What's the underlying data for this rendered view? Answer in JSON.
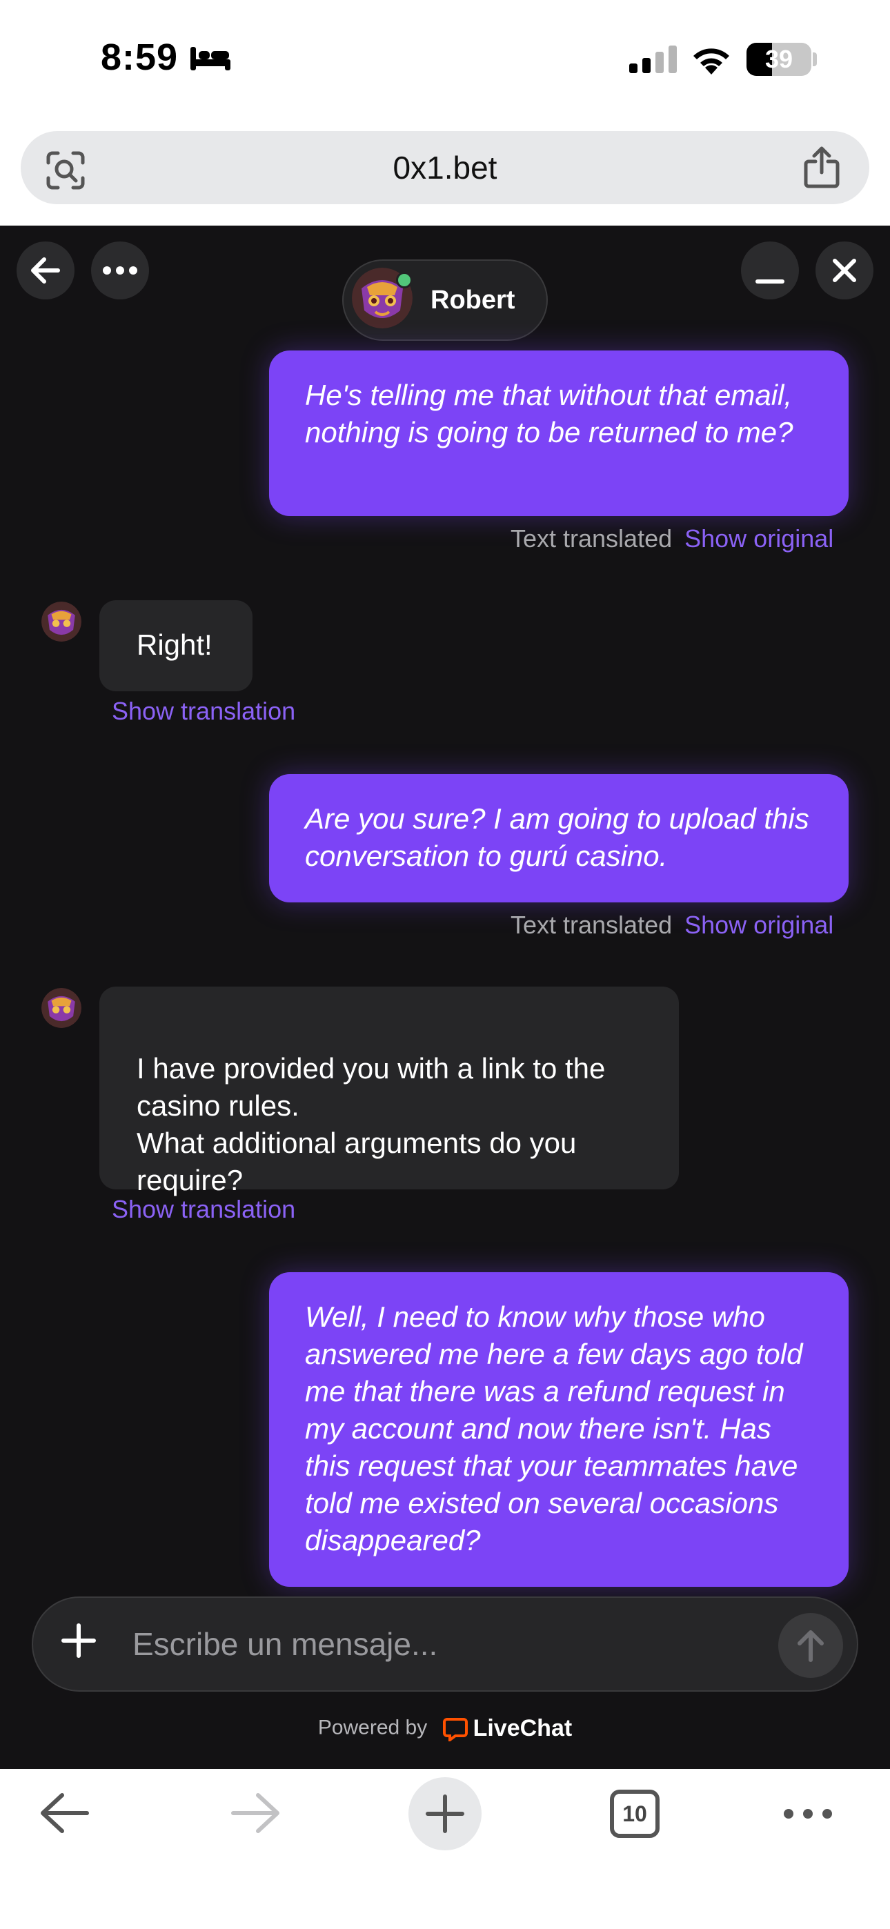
{
  "status_bar": {
    "time": "8:59",
    "battery": "39",
    "battery_level": 0.39
  },
  "browser": {
    "url": "0x1.bet"
  },
  "chat_header": {
    "agent_name": "Robert",
    "agent_online": true
  },
  "messages": [
    {
      "type": "outgoing",
      "text": "He's telling me that without that email, nothing is going to be returned to me?",
      "meta": "Text translated",
      "action": "Show original"
    },
    {
      "type": "incoming",
      "text": "Right!",
      "action": "Show translation"
    },
    {
      "type": "outgoing",
      "text": "Are you sure? I am going to upload this conversation to gurú casino.",
      "meta": "Text translated",
      "action": "Show original"
    },
    {
      "type": "incoming",
      "text": "I have provided you with a link to the casino rules.\nWhat additional arguments do you require?",
      "action": "Show translation"
    },
    {
      "type": "outgoing",
      "text": "Well, I need to know why those who answered me here a few days ago told me that there was a refund request in my account and now there isn't. Has this request that your teammates have told me existed on several occasions disappeared?"
    }
  ],
  "composer": {
    "placeholder": "Escribe un mensaje..."
  },
  "footer": {
    "powered_by": "Powered by",
    "brand": "LiveChat"
  },
  "toolbar": {
    "tab_count": "10"
  },
  "colors": {
    "accent": "#7c44f6",
    "chat_bg": "#131214",
    "incoming_bubble": "#262628",
    "link": "#8b62f5"
  }
}
